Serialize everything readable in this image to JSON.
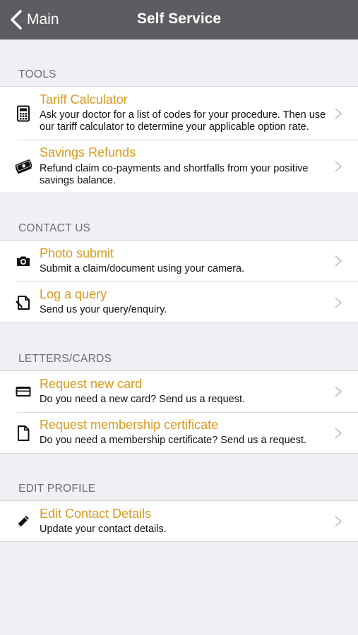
{
  "nav": {
    "back_label": "Main",
    "title": "Self Service"
  },
  "sections": [
    {
      "header": "TOOLS",
      "items": [
        {
          "title": "Tariff Calculator",
          "subtitle": "Ask your doctor for a list of codes for your procedure.  Then use our tariff calculator to determine your applicable option rate.",
          "icon": "calculator-icon"
        },
        {
          "title": "Savings Refunds",
          "subtitle": "Refund claim co-payments and shortfalls from your positive savings balance.",
          "icon": "money-icon"
        }
      ]
    },
    {
      "header": "CONTACT US",
      "items": [
        {
          "title": "Photo submit",
          "subtitle": "Submit a claim/document using your camera.",
          "icon": "camera-icon"
        },
        {
          "title": "Log a query",
          "subtitle": "Send us your query/enquiry.",
          "icon": "edit-document-icon"
        }
      ]
    },
    {
      "header": "LETTERS/CARDS",
      "items": [
        {
          "title": "Request new card",
          "subtitle": "Do you need a new card? Send us a request.",
          "icon": "card-icon"
        },
        {
          "title": "Request membership certificate",
          "subtitle": "Do you need a membership certificate? Send us a request.",
          "icon": "document-icon"
        }
      ]
    },
    {
      "header": "EDIT PROFILE",
      "items": [
        {
          "title": "Edit Contact Details",
          "subtitle": "Update your contact details.",
          "icon": "pencil-icon"
        }
      ]
    }
  ],
  "colors": {
    "nav_bg": "#5b5d60",
    "accent": "#d79a1c",
    "background": "#efeff4"
  }
}
